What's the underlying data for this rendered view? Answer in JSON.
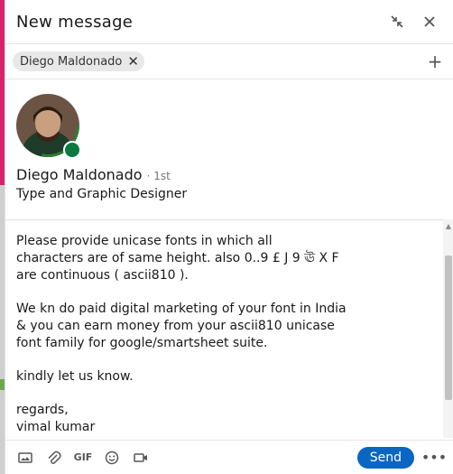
{
  "window": {
    "title": "New message"
  },
  "recipients": {
    "chips": [
      {
        "label": "Diego Maldonado"
      }
    ]
  },
  "profile": {
    "name": "Diego Maldonado",
    "degree": "· 1st",
    "headline": "Type and Graphic Designer",
    "presence_color": "#0a7a3f"
  },
  "message": {
    "paragraphs": [
      "Please provide unicase fonts in which all\ncharacters are of same height. also 0..9 £ J 9 ঊ X F\nare continuous ( ascii810 ).",
      "We kn do paid digital marketing of your font in India\n& you can earn money from your ascii810 unicase\nfont family for google/smartsheet suite.",
      "kindly let us know.",
      "regards,\nvimal kumar"
    ]
  },
  "toolbar": {
    "icons": [
      "image-icon",
      "attach-icon",
      "gif-icon",
      "emoji-icon",
      "video-icon"
    ],
    "gif_label": "GIF",
    "send_label": "Send",
    "send_color": "#0a66c2"
  }
}
